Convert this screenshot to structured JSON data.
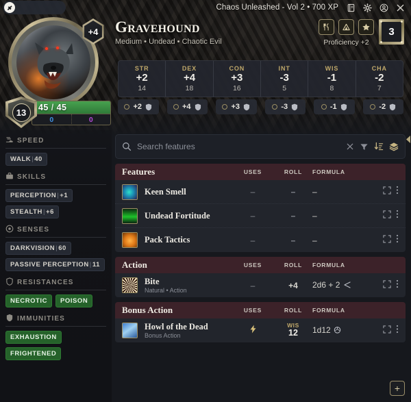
{
  "titlebar": {
    "title": "Chaos Unleashed - Vol 2 • 700 XP",
    "icons": [
      {
        "name": "book-icon",
        "glyph": "book"
      },
      {
        "name": "gear-icon",
        "glyph": "gear"
      },
      {
        "name": "account-icon",
        "glyph": "account"
      },
      {
        "name": "close-icon",
        "glyph": "close"
      }
    ]
  },
  "character": {
    "name": "Gravehound",
    "meta": "Medium • Undead • Chaotic Evil",
    "initiative": "+4",
    "armor_class": "13",
    "level": "3",
    "proficiency": "Proficiency +2",
    "hp_current": "45",
    "hp_separator": "/",
    "hp_max": "45",
    "hp_temp": "0",
    "hp_over": "0"
  },
  "header_buttons": [
    {
      "name": "rest-icon",
      "glyph": "utensils"
    },
    {
      "name": "camp-icon",
      "glyph": "tent"
    },
    {
      "name": "star-icon",
      "glyph": "star"
    }
  ],
  "abilities": [
    {
      "name": "STR",
      "mod": "+2",
      "score": "14",
      "save": "+2"
    },
    {
      "name": "DEX",
      "mod": "+4",
      "score": "18",
      "save": "+4"
    },
    {
      "name": "CON",
      "mod": "+3",
      "score": "16",
      "save": "+3"
    },
    {
      "name": "INT",
      "mod": "-3",
      "score": "5",
      "save": "-3"
    },
    {
      "name": "WIS",
      "mod": "-1",
      "score": "8",
      "save": "-1"
    },
    {
      "name": "CHA",
      "mod": "-2",
      "score": "7",
      "save": "-2"
    }
  ],
  "sidebar": {
    "sections": [
      {
        "name": "speed",
        "label": "SPEED",
        "icon": "boot-icon",
        "style": "plain",
        "tags": [
          {
            "label": "WALK",
            "value": "40"
          }
        ]
      },
      {
        "name": "skills",
        "label": "SKILLS",
        "icon": "briefcase-icon",
        "style": "plain",
        "tags": [
          {
            "label": "PERCEPTION",
            "value": "+1"
          },
          {
            "label": "STEALTH",
            "value": "+6"
          }
        ]
      },
      {
        "name": "senses",
        "label": "SENSES",
        "icon": "eye-icon",
        "style": "plain",
        "tags": [
          {
            "label": "DARKVISION",
            "value": "60"
          },
          {
            "label": "PASSIVE PERCEPTION",
            "value": "11"
          }
        ]
      },
      {
        "name": "resistances",
        "label": "RESISTANCES",
        "icon": "shield-outline-icon",
        "style": "green",
        "tags": [
          {
            "label": "NECROTIC",
            "value": ""
          },
          {
            "label": "POISON",
            "value": ""
          }
        ]
      },
      {
        "name": "immunities",
        "label": "IMMUNITIES",
        "icon": "shield-filled-icon",
        "style": "green",
        "tags": [
          {
            "label": "EXHAUSTION",
            "value": ""
          },
          {
            "label": "FRIGHTENED",
            "value": ""
          }
        ]
      }
    ]
  },
  "search": {
    "placeholder": "Search features",
    "value": "",
    "tools": [
      {
        "name": "clear-search-icon",
        "glyph": "close"
      },
      {
        "name": "filter-icon",
        "glyph": "funnel"
      },
      {
        "name": "sort-descending-icon",
        "glyph": "sort"
      },
      {
        "name": "layers-icon",
        "glyph": "layers"
      }
    ]
  },
  "columns": {
    "uses": "USES",
    "roll": "ROLL",
    "formula": "FORMULA"
  },
  "sections": [
    {
      "name": "features",
      "title": "Features",
      "rows": [
        {
          "name": "Keen Smell",
          "sub": "",
          "icon": "ico-keen",
          "uses": "–",
          "roll": "–",
          "formula": "–",
          "roll_ability": "",
          "bolt": false,
          "arrow": false,
          "die": false
        },
        {
          "name": "Undead Fortitude",
          "sub": "",
          "icon": "ico-fort",
          "uses": "–",
          "roll": "–",
          "formula": "–",
          "roll_ability": "",
          "bolt": false,
          "arrow": false,
          "die": false
        },
        {
          "name": "Pack Tactics",
          "sub": "",
          "icon": "ico-pack",
          "uses": "–",
          "roll": "–",
          "formula": "–",
          "roll_ability": "",
          "bolt": false,
          "arrow": false,
          "die": false
        }
      ]
    },
    {
      "name": "action",
      "title": "Action",
      "rows": [
        {
          "name": "Bite",
          "sub": "Natural • Action",
          "icon": "ico-bite",
          "uses": "–",
          "roll": "+4",
          "formula": "2d6 + 2",
          "roll_ability": "",
          "bolt": false,
          "arrow": true,
          "die": false
        }
      ]
    },
    {
      "name": "bonus-action",
      "title": "Bonus Action",
      "rows": [
        {
          "name": "Howl of the Dead",
          "sub": "Bonus Action",
          "icon": "ico-howl",
          "uses": "",
          "roll": "12",
          "formula": "1d12",
          "roll_ability": "WIS",
          "bolt": true,
          "arrow": false,
          "die": true
        }
      ]
    }
  ],
  "add_button": {
    "label": "+",
    "name": "add-feature-button"
  },
  "colors": {
    "accent_gold": "#c0a86a",
    "section_header": "#3c2229",
    "hp_green": "#47a14f",
    "tag_green": "#25622a",
    "temp_hp_blue": "#3f8fe0",
    "over_hp_purple": "#b24ad6"
  }
}
